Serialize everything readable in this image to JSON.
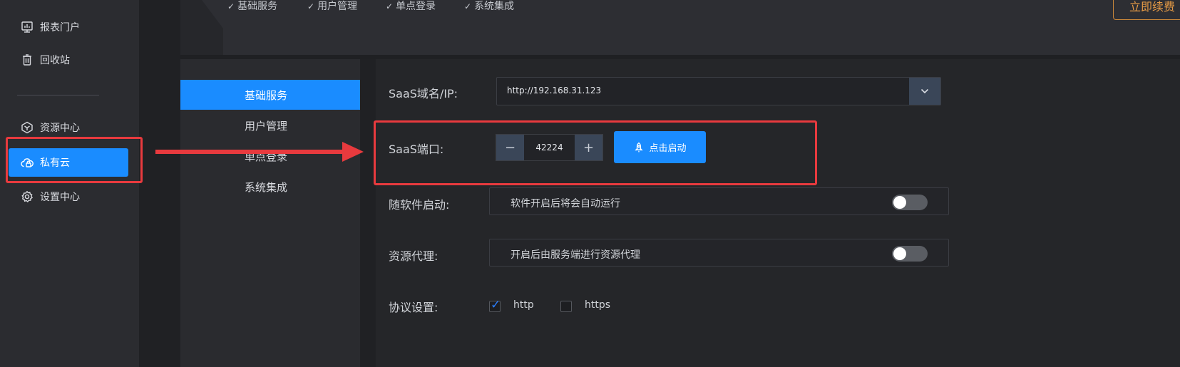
{
  "sidebar": {
    "items": [
      {
        "label": "报表门户",
        "icon": "report-portal-icon"
      },
      {
        "label": "回收站",
        "icon": "trash-icon"
      },
      {
        "label": "资源中心",
        "icon": "resource-hexagon-icon"
      },
      {
        "label": "私有云",
        "icon": "cloud-lock-icon",
        "active": true
      },
      {
        "label": "设置中心",
        "icon": "gear-icon"
      }
    ]
  },
  "top_bar": {
    "checks": [
      "基础服务",
      "用户管理",
      "单点登录",
      "系统集成"
    ],
    "renew_label": "立即续费"
  },
  "submenu": {
    "items": [
      "基础服务",
      "用户管理",
      "单点登录",
      "系统集成"
    ],
    "active_index": 0
  },
  "form": {
    "domain": {
      "label": "SaaS域名/IP:",
      "value": "http://192.168.31.123"
    },
    "port": {
      "label": "SaaS端口:",
      "value": "42224",
      "minus": "−",
      "plus": "+"
    },
    "start_button": {
      "label": "点击启动",
      "icon": "rocket-icon"
    },
    "autostart": {
      "label": "随软件启动:",
      "description": "软件开启后将会自动运行",
      "enabled": false
    },
    "proxy": {
      "label": "资源代理:",
      "description": "开启后由服务端进行资源代理",
      "enabled": false
    },
    "protocol": {
      "label": "协议设置:",
      "options": [
        {
          "label": "http",
          "checked": true
        },
        {
          "label": "https",
          "checked": false
        }
      ]
    }
  },
  "colors": {
    "accent": "#1a8cff",
    "annotation": "#e83a3e",
    "renew": "#e59a45"
  }
}
